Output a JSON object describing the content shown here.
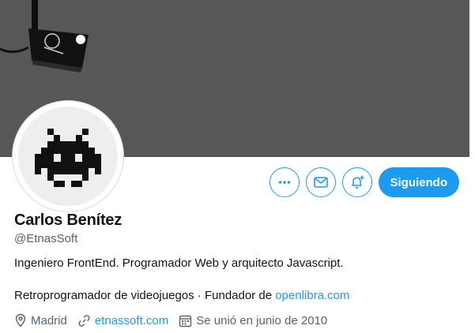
{
  "profile": {
    "name": "Carlos Benítez",
    "handle": "@EtnasSoft",
    "bio_line1": "Ingeniero FrontEnd. Programador Web y arquitecto Javascript.",
    "bio_line2_prefix": "Retroprogramador de videojuegos · Fundador de ",
    "bio_line2_link": "openlibra.com",
    "location": "Madrid",
    "website": "etnassoft.com",
    "joined": "Se unió en junio de 2010"
  },
  "actions": {
    "more_icon": "more-icon",
    "message_icon": "mail-icon",
    "notify_icon": "bell-plus-icon",
    "follow_label": "Siguiendo"
  },
  "colors": {
    "accent": "#1d9bf0",
    "banner": "#575757",
    "secondary_text": "#536471"
  }
}
